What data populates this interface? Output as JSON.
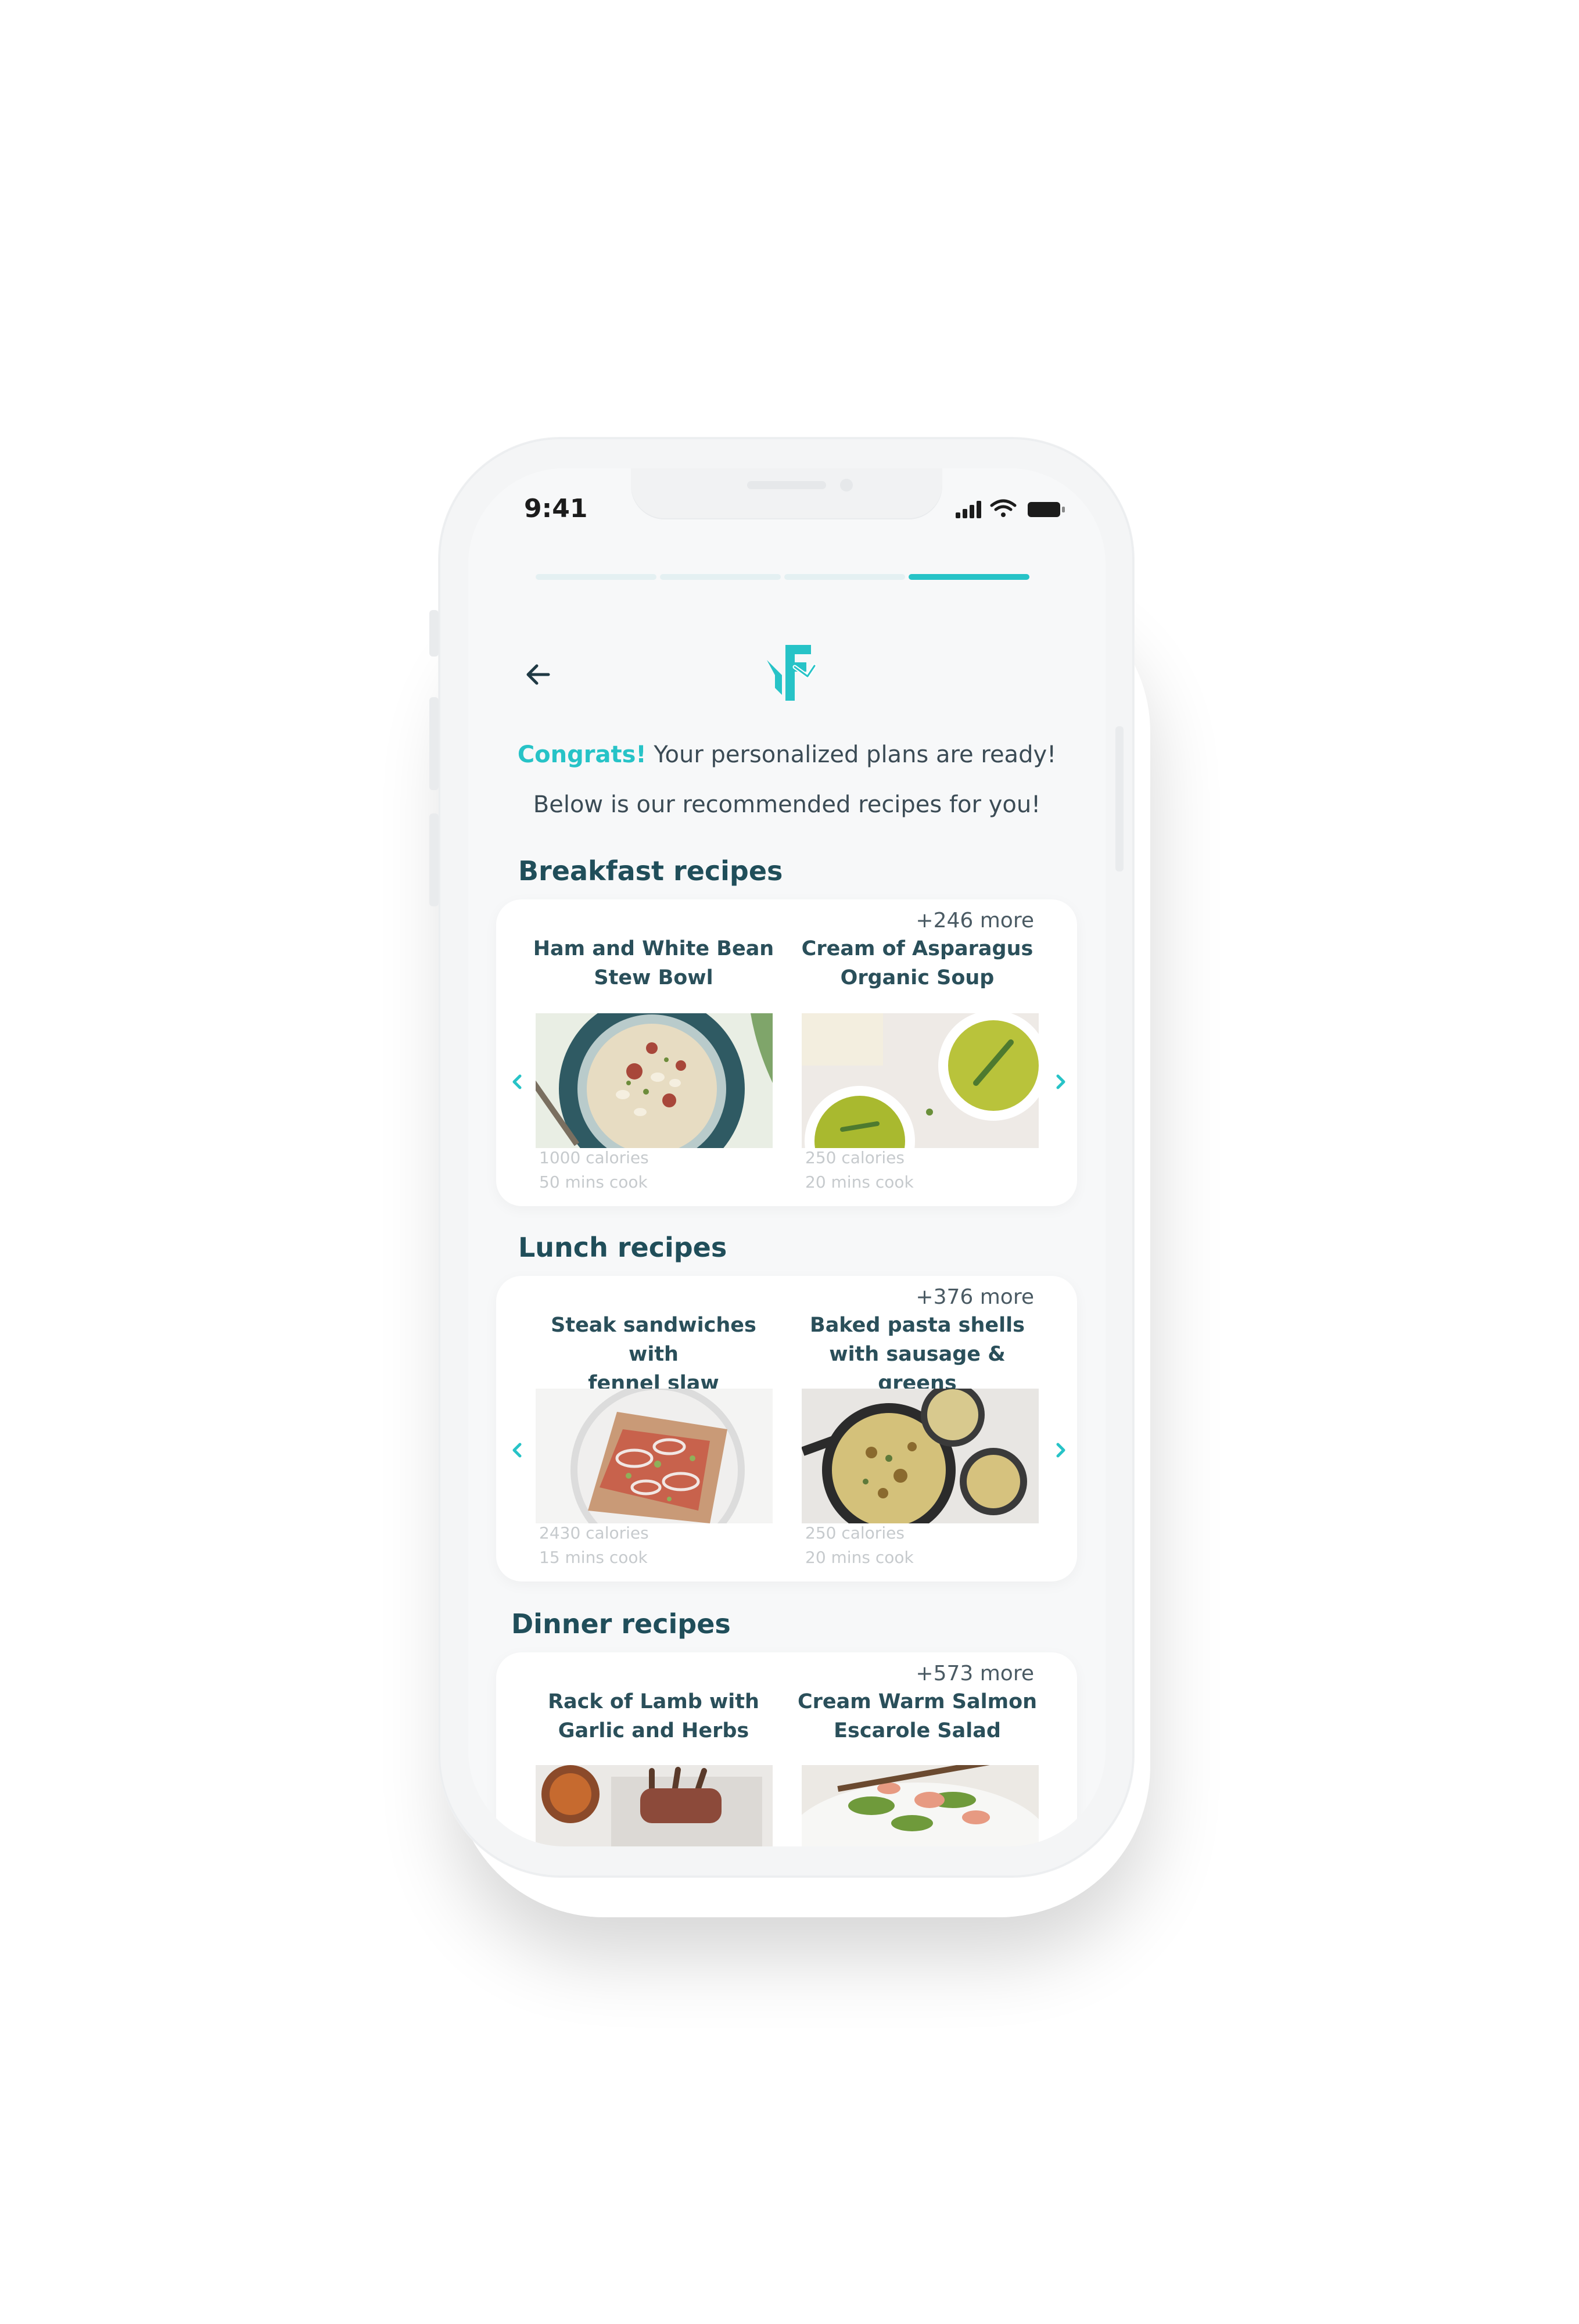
{
  "status_bar": {
    "time": "9:41"
  },
  "progress": {
    "steps": 4,
    "current": 4
  },
  "header": {
    "congrats_highlight": "Congrats!",
    "congrats_rest": " Your personalized plans are ready!",
    "subtitle": "Below is our recommended recipes for you!"
  },
  "sections": [
    {
      "title": "Breakfast recipes",
      "more": "+246 more",
      "recipes": [
        {
          "title_line1": "Ham and White Bean",
          "title_line2": "Stew Bowl",
          "calories": "1000 calories",
          "cook": "50 mins cook"
        },
        {
          "title_line1": "Cream of Asparagus",
          "title_line2": "Organic Soup",
          "calories": "250 calories",
          "cook": "20 mins cook"
        }
      ]
    },
    {
      "title": "Lunch recipes",
      "more": "+376 more",
      "recipes": [
        {
          "title_line1": "Steak sandwiches with",
          "title_line2": "fennel slaw",
          "calories": "2430 calories",
          "cook": "15 mins cook"
        },
        {
          "title_line1": "Baked pasta shells",
          "title_line2": "with sausage & greens",
          "calories": "250 calories",
          "cook": "20 mins cook"
        }
      ]
    },
    {
      "title": "Dinner recipes",
      "more": "+573 more",
      "recipes": [
        {
          "title_line1": "Rack of Lamb with",
          "title_line2": "Garlic and Herbs"
        },
        {
          "title_line1": "Cream Warm Salmon",
          "title_line2": "Escarole Salad"
        }
      ]
    }
  ],
  "colors": {
    "accent": "#27c3c7",
    "title": "#204e5a",
    "text": "#3b4b55"
  },
  "icons": {
    "back": "arrow-left-icon",
    "logo": "brand-logo-icon",
    "prev": "chevron-left-icon",
    "next": "chevron-right-icon"
  }
}
